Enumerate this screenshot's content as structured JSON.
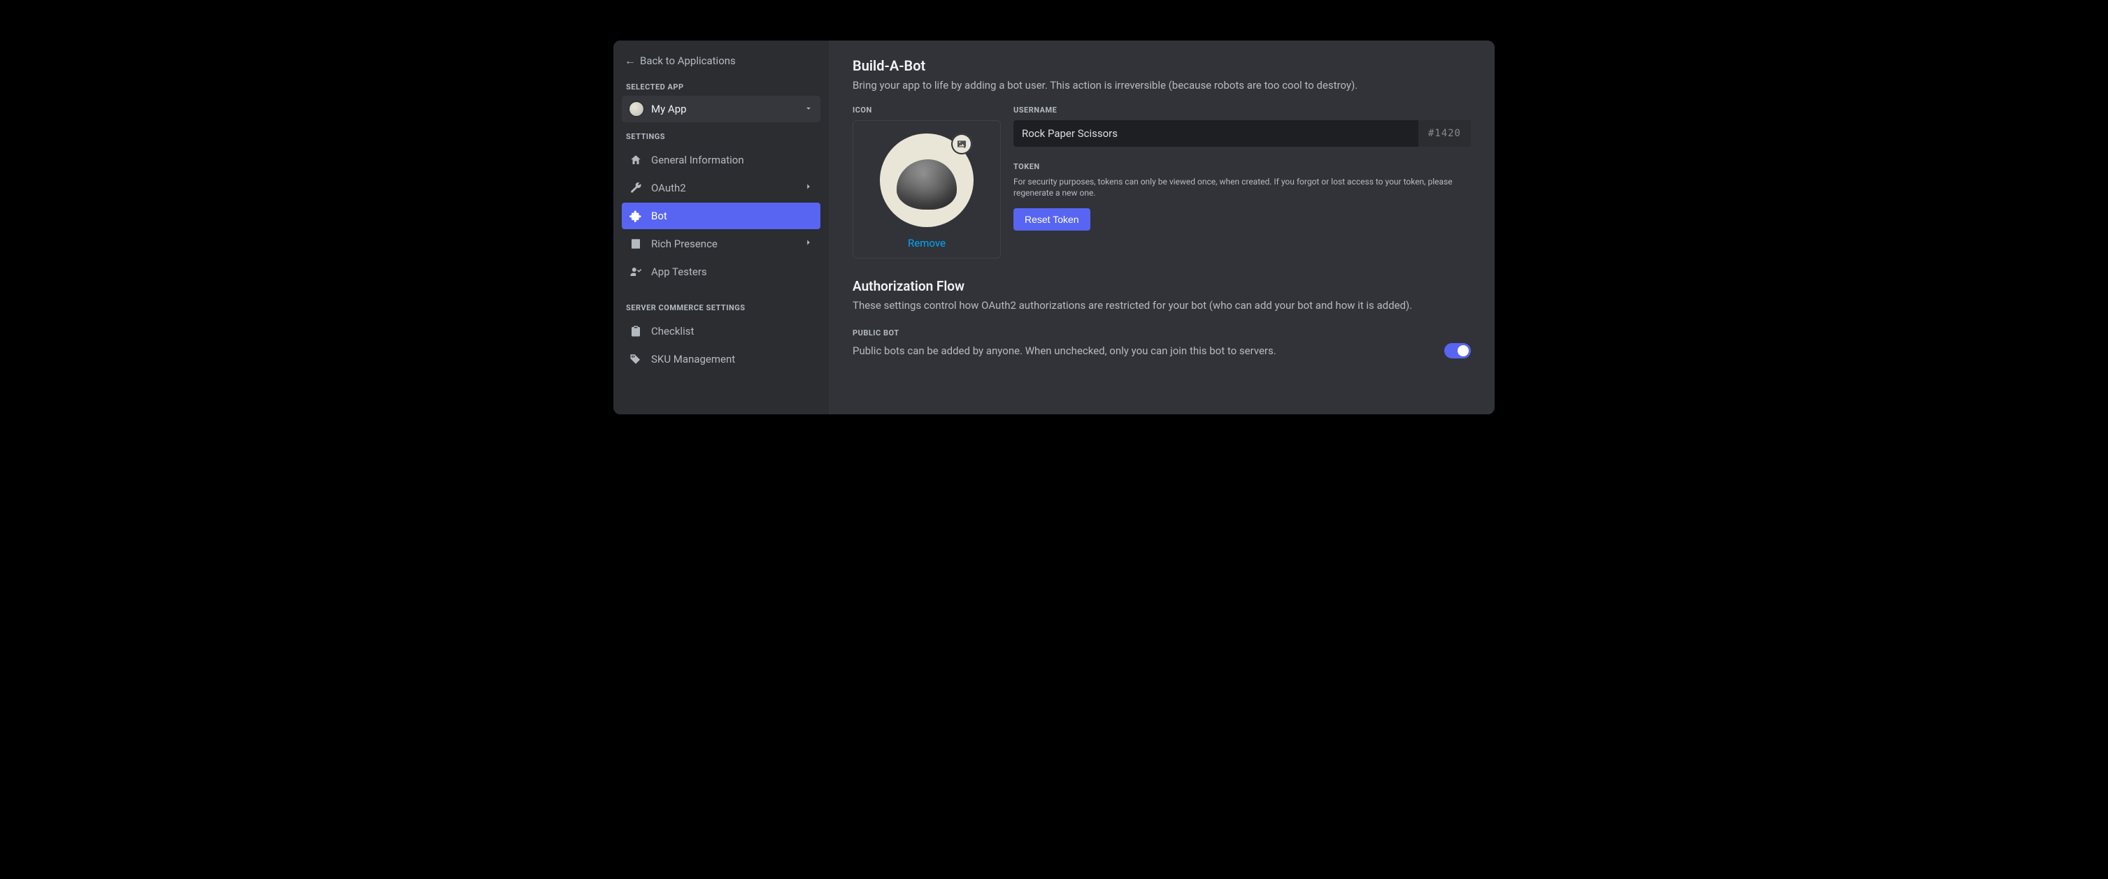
{
  "back": {
    "label": "Back to Applications"
  },
  "sidebar": {
    "selected_app_label": "SELECTED APP",
    "app_name": "My App",
    "settings_label": "SETTINGS",
    "items": [
      {
        "label": "General Information"
      },
      {
        "label": "OAuth2"
      },
      {
        "label": "Bot"
      },
      {
        "label": "Rich Presence"
      },
      {
        "label": "App Testers"
      }
    ],
    "commerce_label": "SERVER COMMERCE SETTINGS",
    "commerce_items": [
      {
        "label": "Checklist"
      },
      {
        "label": "SKU Management"
      }
    ]
  },
  "main": {
    "title": "Build-A-Bot",
    "subtitle": "Bring your app to life by adding a bot user. This action is irreversible (because robots are too cool to destroy).",
    "icon_label": "ICON",
    "remove_label": "Remove",
    "username_label": "USERNAME",
    "username_value": "Rock Paper Scissors",
    "discriminator": "#1420",
    "token_label": "TOKEN",
    "token_note": "For security purposes, tokens can only be viewed once, when created. If you forgot or lost access to your token, please regenerate a new one.",
    "reset_token_label": "Reset Token",
    "auth_flow_title": "Authorization Flow",
    "auth_flow_sub": "These settings control how OAuth2 authorizations are restricted for your bot (who can add your bot and how it is added).",
    "public_bot_label": "PUBLIC BOT",
    "public_bot_desc": "Public bots can be added by anyone. When unchecked, only you can join this bot to servers.",
    "public_bot_enabled": true
  }
}
